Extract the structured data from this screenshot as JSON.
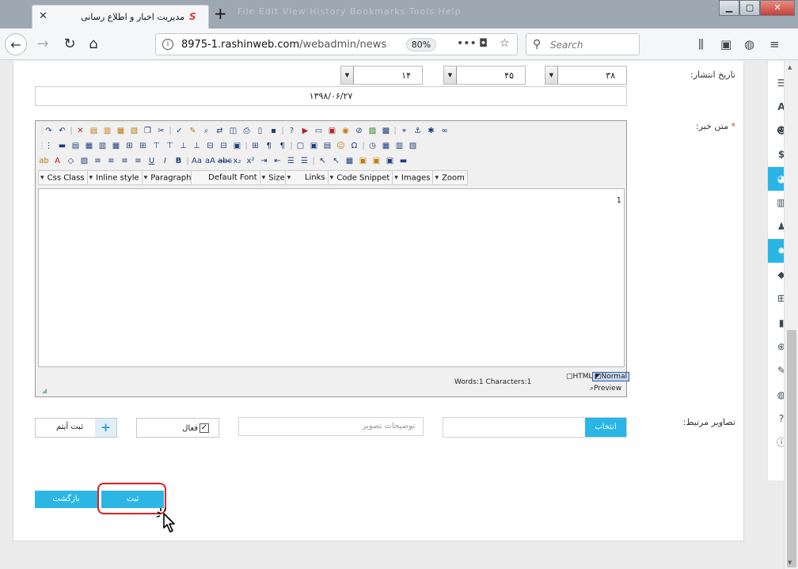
{
  "browser": {
    "tab_title": "مدیریت اخبار و اطلاع رسانی",
    "close_symbol": "✕",
    "newtab_symbol": "+",
    "url_host": "8975-1.rashinweb.com",
    "url_path": "/webadmin/news",
    "zoom": "80%",
    "search_placeholder": "Search",
    "ghost_menu": "File   Edit   View   History   Bookmarks   Tools   Help",
    "win_min": "▁",
    "win_max": "▢",
    "win_close": "✕"
  },
  "form": {
    "publish_label": "تاریخ انتشار:",
    "date_selects": [
      "۳۸",
      "۴۵",
      "۱۴"
    ],
    "date_value": "۱۳۹۸/۰۶/۲۷",
    "body_label": "متن خبر:",
    "required_mark": "*",
    "images_label": "تصاویر مرتبط:",
    "select_button": "انتخاب",
    "image_desc_placeholder": "توضیحات تصویر",
    "active_label": "فعال",
    "active_checked": "✓",
    "add_item_label": "ثبت آیتم",
    "add_item_plus": "+",
    "save_button": "ثبت",
    "back_button": "بازگشت"
  },
  "editor": {
    "dropdowns": [
      "Css Class",
      "Inline style",
      "Paragraph",
      "Default Font",
      "Size",
      "Links",
      "Code Snippet",
      "Images",
      "Zoom"
    ],
    "content": "1",
    "word_count": "Words:1 Characters:1",
    "mode_html": "HTML",
    "mode_normal": "Normal",
    "mode_preview": "Preview"
  },
  "sidebar_icons": [
    "list-icon",
    "text-icon",
    "users-icon",
    "dollar-icon",
    "pie-chart-icon",
    "bar-chart-icon",
    "user-icon",
    "gear-icon",
    "tags-icon",
    "windows-icon",
    "document-icon",
    "zoom-icon",
    "wrench-icon",
    "globe-icon",
    "help-icon",
    "info-icon"
  ],
  "sidebar_active": [
    "pie-chart-icon",
    "gear-icon"
  ]
}
